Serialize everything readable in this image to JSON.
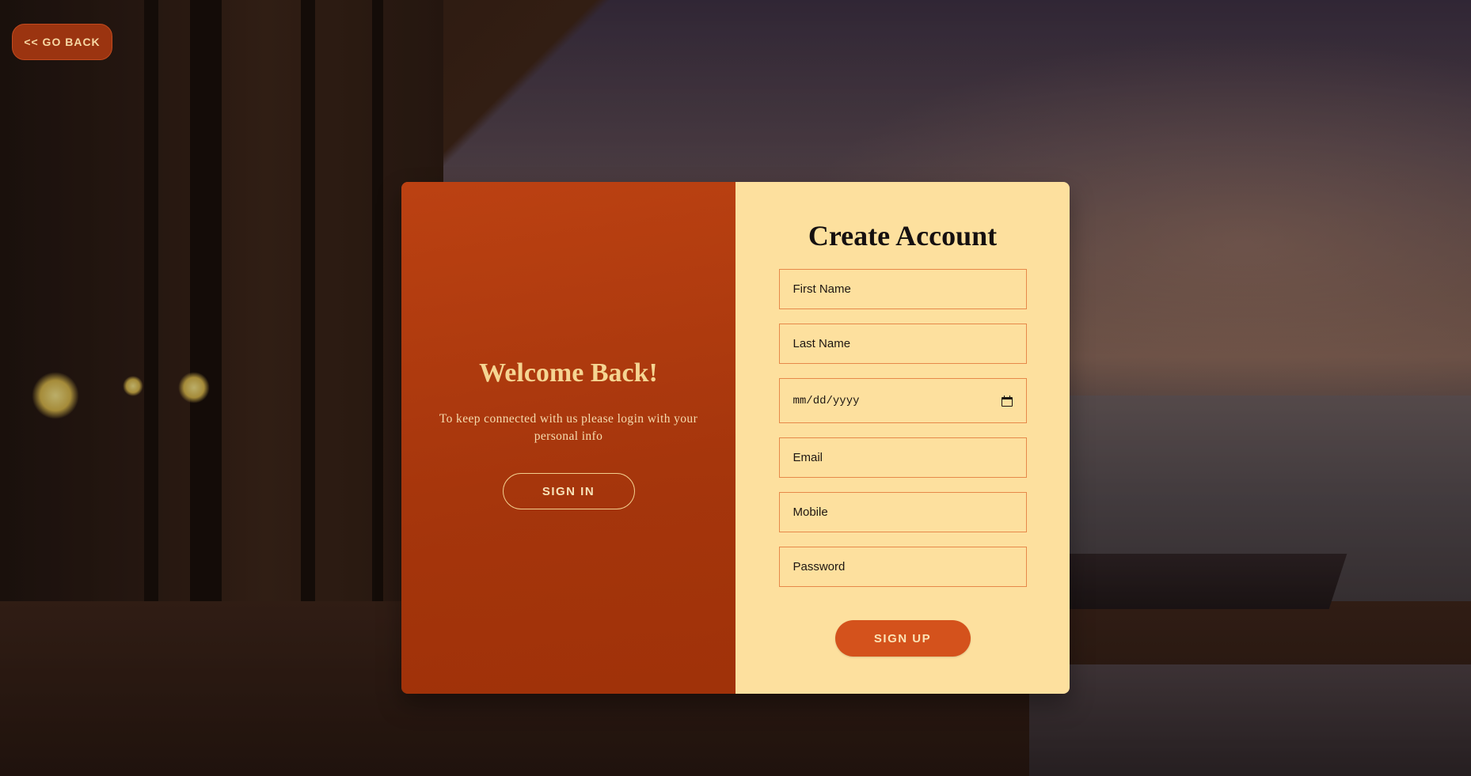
{
  "nav": {
    "go_back_label": "<< GO BACK"
  },
  "welcome": {
    "title": "Welcome Back!",
    "subtitle": "To keep connected with us please login with your personal info",
    "sign_in_label": "SIGN IN"
  },
  "signup": {
    "title": "Create Account",
    "fields": {
      "first_name": "First Name",
      "last_name": "Last Name",
      "dob": "mm/dd/yyyy",
      "email": "Email",
      "mobile": "Mobile",
      "password": "Password"
    },
    "sign_up_label": "SIGN UP"
  },
  "colors": {
    "accent": "#d4521c",
    "left_panel": "#b73a0c",
    "right_panel": "#fde09e",
    "field_border": "#e6894a",
    "heading_gold": "#f5d592"
  },
  "icons": {
    "date_picker": "calendar-icon"
  }
}
